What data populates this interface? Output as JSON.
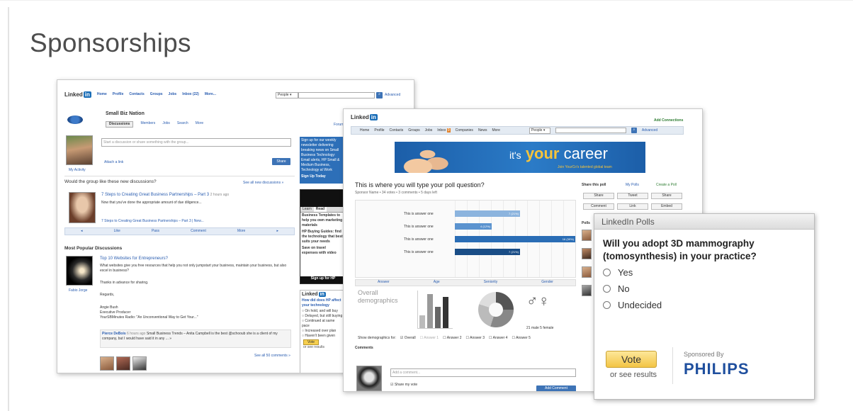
{
  "slide": {
    "title": "Sponsorships"
  },
  "group_page": {
    "nav": [
      "Home",
      "Profile",
      "Contacts",
      "Groups",
      "Jobs",
      "Inbox (22)",
      "More..."
    ],
    "search_scope": "People",
    "advanced": "Advanced",
    "group_name": "Small Biz Nation",
    "tabs": [
      "Discussions",
      "Members",
      "Jobs",
      "Search",
      "More"
    ],
    "forum_label": "Forum",
    "start_discussion_placeholder": "Start a discussion or share something with the group...",
    "attach_link": "Attach a link",
    "share": "Share",
    "my_activity": "My Activity",
    "prompt": "Would the group like these new discussions?",
    "see_all": "See all new discussions »",
    "discussion_1": {
      "title": "7 Steps to Creating Great Business Partnerships – Part 3",
      "time": "2 hours ago",
      "text": "Now that you've done the appropriate amount of due diligence..."
    },
    "discussion_2_title": "7 Steps to Creating Great Business Partnerships – Part 3 | New...",
    "actions": [
      "Like",
      "Pass",
      "Comment",
      "More"
    ],
    "popular_heading": "Most Popular Discussions",
    "popular_1": {
      "title": "Top 10 Websites for Entrepreneurs?",
      "text": "What websites give you free resources that help you not only jumpstart your business, maintain your business, but also excel in business?",
      "author": "Fabio Jorge"
    },
    "thanks": "Thanks in advance for sharing.",
    "regards": "Regards,",
    "signature": [
      "Angie Bush",
      "Executive Producer",
      "YourSBMinutes Radio: \"An Unconventional Way to Get Your...\""
    ],
    "comment": {
      "author": "Pierce DeBois",
      "time": "6 hours ago",
      "text": "Small Business Trends – Anita Campbell is the best @schooub  she is a client of my company, but I would have said it in any ... »"
    },
    "see_all_comments": "See all 50 comments »",
    "ad_text": "Sign up for our weekly newsletter delivering breaking news on Small Business Technology: Email alerts, HP Small & Medium Business, Technology at Work",
    "ad_signup": "Sign Up Today",
    "ad2_tabs": [
      "Learn",
      "Read"
    ],
    "ad2_text": "Business Templates to help you own marketing materials",
    "ad2_guides": "HP Buying Guides: find the technology that best suits your needs",
    "ad2_travel": "Save on travel expenses with video",
    "ad2_signup": "Sign up for HP",
    "poll_logo": "Linked",
    "mini_poll": {
      "question": "How did does HP affect your technology",
      "options": [
        "On hold, and will buy",
        "Delayed, but still buying",
        "Continued at same pace",
        "Increased over plan",
        "Haven't been given"
      ],
      "vote": "Vote",
      "results": "or see results"
    }
  },
  "poll_page": {
    "add_connections": "Add Connections",
    "nav": [
      "Home",
      "Profile",
      "Contacts",
      "Groups",
      "Jobs",
      "Inbox",
      "Companies",
      "News",
      "More"
    ],
    "inbox_count": "9",
    "search_scope": "People",
    "advanced": "Advanced",
    "banner": {
      "lead": "it's",
      "accent": "your",
      "tail": "career",
      "sub": "Join YourCo's talented global team"
    },
    "question": "This is where you will type your poll question?",
    "meta": "Sponsor Name  •  34 votes  •  3 comments  •  5 days left",
    "share_this_poll": "Share this poll",
    "my_polls": "My Polls",
    "create_poll": "Create a Poll",
    "share_buttons": [
      "Share",
      "Tweet",
      "Share",
      "Comment",
      "Link",
      "Embed"
    ],
    "polls_label": "Polls",
    "answers": [
      {
        "label": "This is answer one",
        "votes": "7 (21%)",
        "pct": 21
      },
      {
        "label": "This is answer one",
        "votes": "4 (12%)",
        "pct": 12
      },
      {
        "label": "This is answer one",
        "votes": "16 (39%)",
        "pct": 39
      },
      {
        "label": "This is answer one",
        "votes": "7 (21%)",
        "pct": 21
      }
    ],
    "demo_headers": [
      "Answer",
      "Age",
      "Seniority",
      "Gender"
    ],
    "overall_label": "Overall demographics",
    "gender_counts": "21 male   5 female",
    "show_label": "Show demographics for:",
    "show_options": [
      "Overall",
      "Answer 1",
      "Answer 2",
      "Answer 3",
      "Answer 4",
      "Answer 5"
    ],
    "comments_heading": "Comments",
    "add_comment_placeholder": "Add a comment...",
    "share_vote": "Share my vote",
    "add_comment_btn": "Add Comment"
  },
  "poll_widget": {
    "header": "LinkedIn Polls",
    "question": "Will you adopt 3D mammography (tomosynthesis) in your practice?",
    "options": [
      "Yes",
      "No",
      "Undecided"
    ],
    "vote": "Vote",
    "see_results": "or see results",
    "sponsored_by": "Sponsored By",
    "sponsor": "PHILIPS",
    "sponsor_color": "#1f4f9e"
  }
}
